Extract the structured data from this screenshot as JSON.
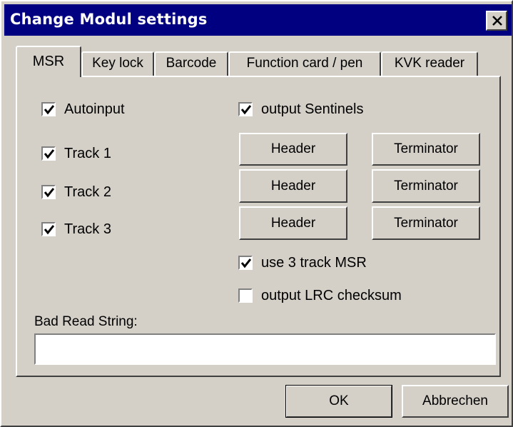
{
  "window": {
    "title": "Change Modul settings"
  },
  "tabs": [
    {
      "label": "MSR",
      "active": true
    },
    {
      "label": "Key lock",
      "active": false
    },
    {
      "label": "Barcode",
      "active": false
    },
    {
      "label": "Function card / pen",
      "active": false
    },
    {
      "label": "KVK reader",
      "active": false
    }
  ],
  "msr": {
    "autoinput": {
      "label": "Autoinput",
      "checked": true
    },
    "output_sentinels": {
      "label": "output Sentinels",
      "checked": true
    },
    "tracks": [
      {
        "label": "Track 1",
        "checked": true,
        "header_label": "Header",
        "terminator_label": "Terminator"
      },
      {
        "label": "Track 2",
        "checked": true,
        "header_label": "Header",
        "terminator_label": "Terminator"
      },
      {
        "label": "Track 3",
        "checked": true,
        "header_label": "Header",
        "terminator_label": "Terminator"
      }
    ],
    "use_3_track": {
      "label": "use 3 track MSR",
      "checked": true
    },
    "output_lrc": {
      "label": "output LRC checksum",
      "checked": false
    },
    "bad_read_label": "Bad Read String:",
    "bad_read_value": ""
  },
  "footer": {
    "ok_label": "OK",
    "cancel_label": "Abbrechen"
  },
  "colors": {
    "titlebar": "#000080",
    "face": "#d4d0c8"
  }
}
